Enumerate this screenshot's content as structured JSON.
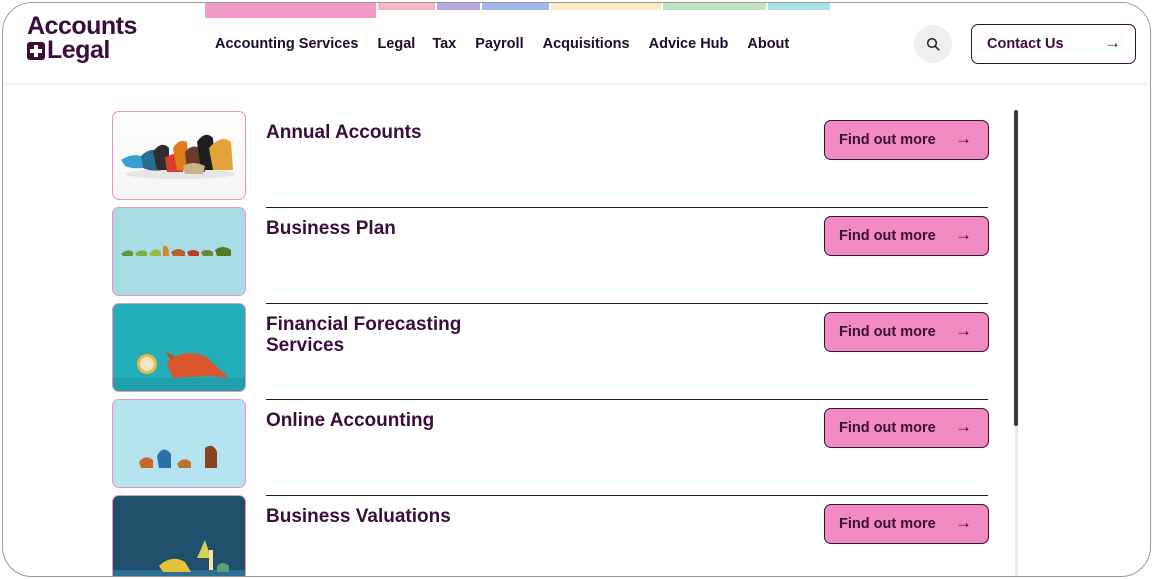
{
  "colors": {
    "brand_dark": "#3a0d3b",
    "accent_pink": "#f28bc0",
    "strips": [
      "#f29ac8",
      "#f5b7c3",
      "#b5a6de",
      "#9fb7e9",
      "#f7ecc0",
      "#bde6c0",
      "#a8e1ea"
    ]
  },
  "logo": {
    "line1": "Accounts",
    "line2": "Legal",
    "icon": "plus-box-icon"
  },
  "nav": {
    "items": [
      {
        "label": "Accounting Services"
      },
      {
        "label": "Legal"
      },
      {
        "label": "Tax"
      },
      {
        "label": "Payroll"
      },
      {
        "label": "Acquisitions"
      },
      {
        "label": "Advice Hub"
      },
      {
        "label": "About"
      }
    ]
  },
  "header": {
    "search_icon": "search-icon",
    "contact_label": "Contact Us",
    "contact_arrow": "→"
  },
  "services": [
    {
      "title": "Annual Accounts",
      "button": "Find out more",
      "arrow": "→"
    },
    {
      "title": "Business Plan",
      "button": "Find out more",
      "arrow": "→"
    },
    {
      "title": "Financial Forecasting Services",
      "button": "Find out more",
      "arrow": "→"
    },
    {
      "title": "Online Accounting",
      "button": "Find out more",
      "arrow": "→"
    },
    {
      "title": "Business Valuations",
      "button": "Find out more",
      "arrow": "→"
    }
  ]
}
